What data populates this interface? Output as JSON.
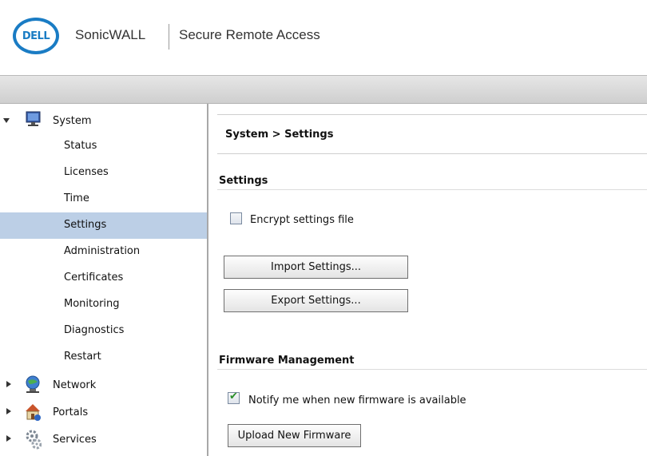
{
  "header": {
    "logo_text": "DELL",
    "brand": "SonicWALL",
    "product": "Secure Remote Access"
  },
  "sidebar": {
    "groups": [
      {
        "label": "System",
        "icon": "monitor-icon",
        "expanded": true
      },
      {
        "label": "Network",
        "icon": "globe-network-icon",
        "expanded": false
      },
      {
        "label": "Portals",
        "icon": "house-icon",
        "expanded": false
      },
      {
        "label": "Services",
        "icon": "gears-icon",
        "expanded": false
      }
    ],
    "system_items": [
      "Status",
      "Licenses",
      "Time",
      "Settings",
      "Administration",
      "Certificates",
      "Monitoring",
      "Diagnostics",
      "Restart"
    ],
    "active_item": "Settings"
  },
  "main": {
    "breadcrumb": "System > Settings",
    "settings_title": "Settings",
    "encrypt_label": "Encrypt settings file",
    "encrypt_checked": false,
    "import_button": "Import Settings...",
    "export_button": "Export Settings...",
    "firmware_title": "Firmware Management",
    "notify_label": "Notify me when new firmware is available",
    "notify_checked": true,
    "upload_button": "Upload New Firmware"
  },
  "colors": {
    "accent_blue": "#1a7cc4",
    "active_item_bg": "#bccfe6",
    "check_green": "#2a8f2a"
  }
}
